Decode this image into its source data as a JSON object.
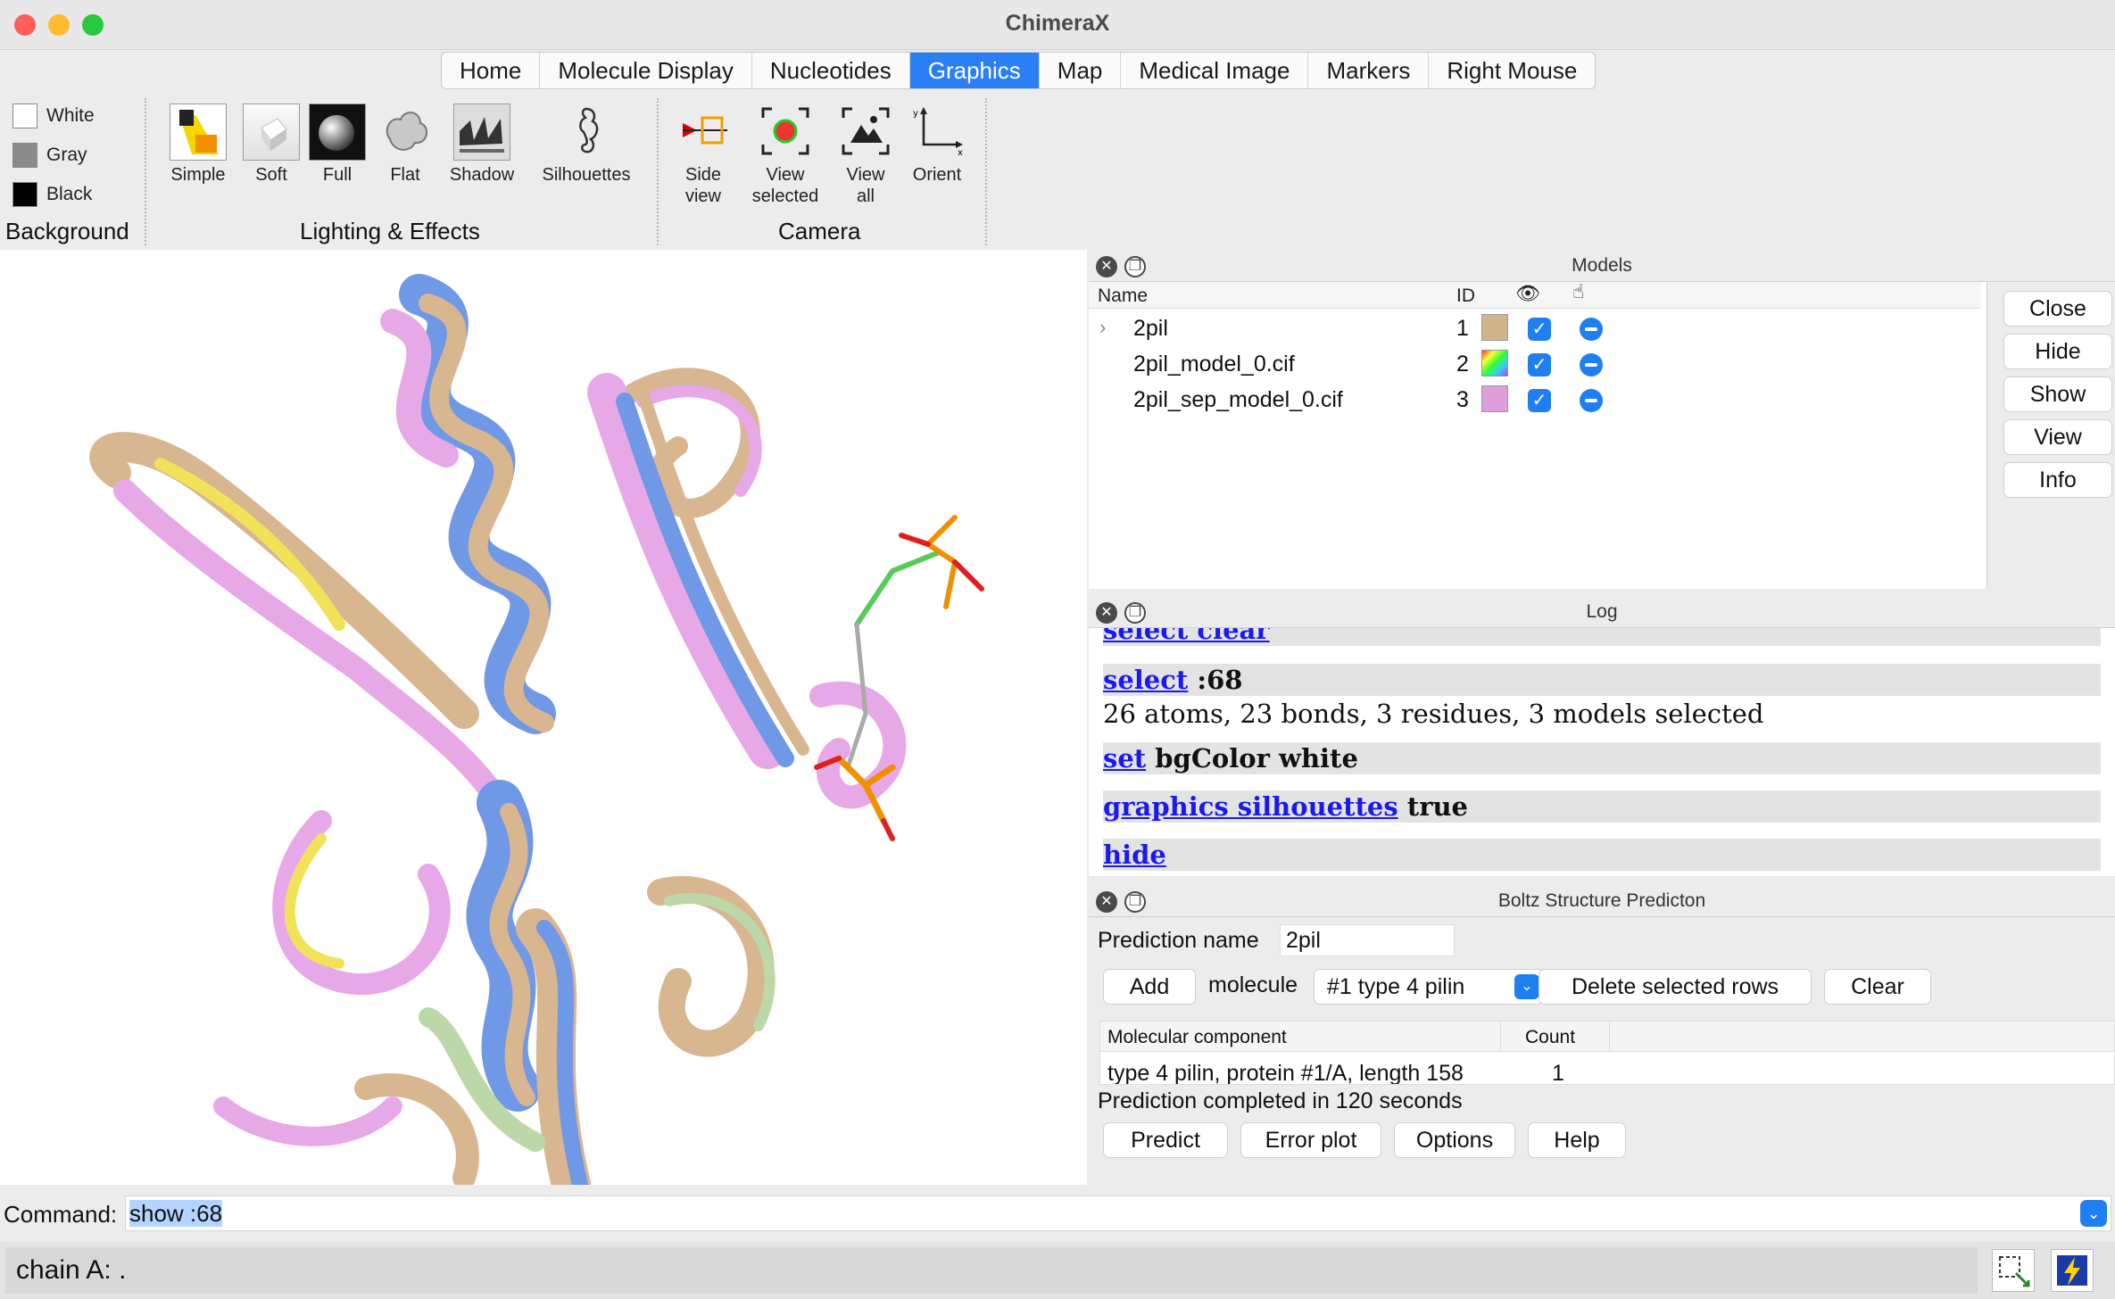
{
  "window": {
    "title": "ChimeraX"
  },
  "tabs": [
    {
      "label": "Home"
    },
    {
      "label": "Molecule Display"
    },
    {
      "label": "Nucleotides"
    },
    {
      "label": "Graphics",
      "active": true
    },
    {
      "label": "Map"
    },
    {
      "label": "Medical Image"
    },
    {
      "label": "Markers"
    },
    {
      "label": "Right Mouse"
    }
  ],
  "ribbon": {
    "background": {
      "label": "Background",
      "options": [
        "White",
        "Gray",
        "Black"
      ]
    },
    "lighting": {
      "label": "Lighting & Effects",
      "tools": [
        "Simple",
        "Soft",
        "Full",
        "Flat",
        "Shadow",
        "Silhouettes"
      ]
    },
    "camera": {
      "label": "Camera",
      "tools": [
        [
          "Side",
          "view"
        ],
        [
          "View",
          "selected"
        ],
        [
          "View",
          "all"
        ],
        [
          "Orient",
          ""
        ]
      ]
    }
  },
  "models": {
    "title": "Models",
    "columns": {
      "name": "Name",
      "id": "ID"
    },
    "rows": [
      {
        "name": "2pil",
        "id": "1",
        "color": "#d2b48c"
      },
      {
        "name": "2pil_model_0.cif",
        "id": "2",
        "color": "rainbow"
      },
      {
        "name": "2pil_sep_model_0.cif",
        "id": "3",
        "color": "#dda0dd"
      }
    ],
    "buttons": [
      "Close",
      "Hide",
      "Show",
      "View",
      "Info"
    ]
  },
  "log": {
    "title": "Log",
    "partial": "select clear",
    "lines": {
      "select_cmd": "select",
      "select_arg": " :68",
      "result": "26 atoms, 23 bonds, 3 residues, 3 models selected",
      "set_cmd": "set",
      "set_arg": " bgColor white",
      "sil_cmd": "graphics silhouettes",
      "sil_arg": " true",
      "hide_cmd": "hide"
    }
  },
  "boltz": {
    "title": "Boltz Structure Predicton",
    "prediction_label": "Prediction name",
    "prediction_value": "2pil",
    "add": "Add",
    "molecule_label": "molecule",
    "molecule_value": "#1 type 4 pilin",
    "delete": "Delete selected rows",
    "clear": "Clear",
    "col_component": "Molecular component",
    "col_count": "Count",
    "row_component": "type 4 pilin, protein #1/A, length 158",
    "row_count": "1",
    "status": "Prediction completed in 120 seconds",
    "buttons": [
      "Predict",
      "Error plot",
      "Options",
      "Help"
    ]
  },
  "command": {
    "label": "Command:",
    "value": "show :68"
  },
  "status": {
    "text": "chain A: ."
  }
}
